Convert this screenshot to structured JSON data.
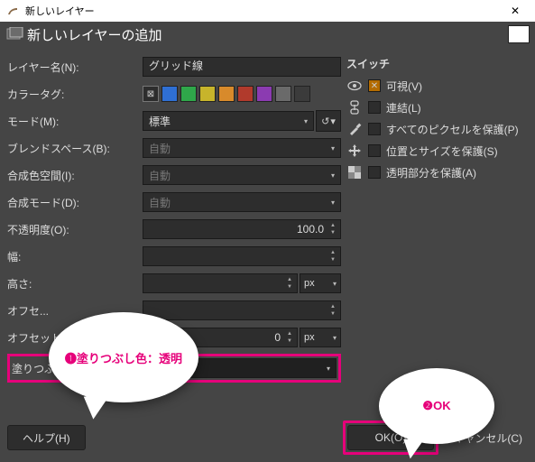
{
  "window": {
    "title": "新しいレイヤー",
    "close": "✕"
  },
  "header": {
    "title": "新しいレイヤーの追加"
  },
  "labels": {
    "layer_name": "レイヤー名(N):",
    "color_tag": "カラータグ:",
    "mode": "モード(M):",
    "blend_space": "ブレンドスペース(B):",
    "composite_space": "合成色空間(I):",
    "composite_mode": "合成モード(D):",
    "opacity": "不透明度(O):",
    "width": "幅:",
    "height": "高さ:",
    "offset_x": "オフセ...",
    "offset_y": "オフセット Y:",
    "fill": "塗りつぶし色(F):",
    "help": "ヘルプ(H)",
    "ok": "OK(O)",
    "cancel": "キャンセル(C)"
  },
  "values": {
    "layer_name": "グリッド線",
    "mode": "標準",
    "blend_space": "自動",
    "composite_space": "自動",
    "composite_mode": "自動",
    "opacity": "100.0",
    "width": "",
    "height": "",
    "offset_x": "",
    "offset_y": "0",
    "unit": "px",
    "fill": "透明"
  },
  "color_tags": [
    "#2d2d2d",
    "#2f6fd3",
    "#2fa74a",
    "#c7b42b",
    "#d88a2b",
    "#b13a2c",
    "#8b3bb1",
    "#6a6a6a",
    "#3b3b3b"
  ],
  "switches": {
    "title": "スイッチ",
    "items": [
      {
        "icon": "eye",
        "checked": true,
        "label": "可視(V)"
      },
      {
        "icon": "link",
        "checked": false,
        "label": "連結(L)"
      },
      {
        "icon": "brush",
        "checked": false,
        "label": "すべてのピクセルを保護(P)"
      },
      {
        "icon": "move",
        "checked": false,
        "label": "位置とサイズを保護(S)"
      },
      {
        "icon": "alpha",
        "checked": false,
        "label": "透明部分を保護(A)"
      }
    ]
  },
  "callouts": {
    "c1": "❶塗りつぶし色：透明",
    "c2": "❷OK"
  }
}
